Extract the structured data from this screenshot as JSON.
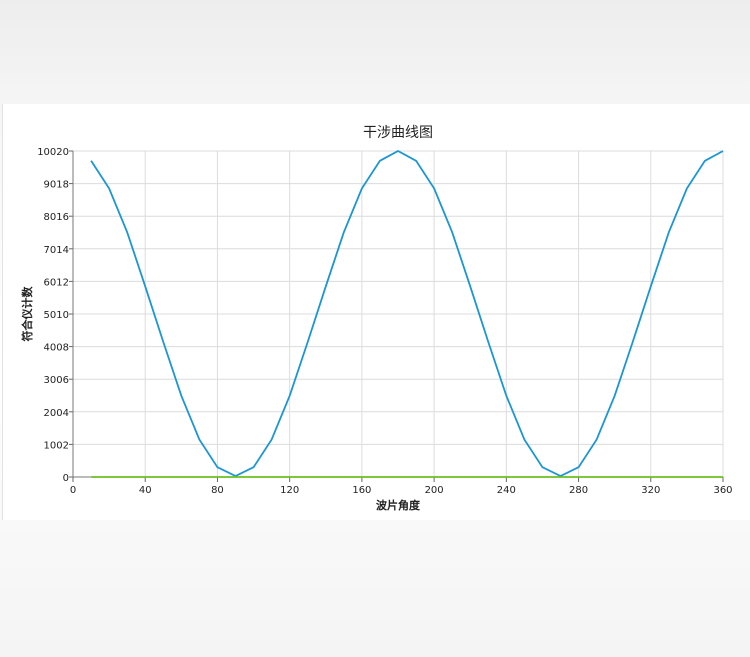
{
  "chart_data": {
    "type": "line",
    "title": "干涉曲线图",
    "xlabel": "波片角度",
    "ylabel": "符合仪计数",
    "xlim": [
      0,
      360
    ],
    "ylim": [
      0,
      10020
    ],
    "x_ticks": [
      "0",
      "40",
      "80",
      "120",
      "160",
      "200",
      "240",
      "280",
      "320",
      "360"
    ],
    "y_ticks": [
      "0",
      "1002",
      "2004",
      "3006",
      "4008",
      "5010",
      "6012",
      "7014",
      "8016",
      "9018",
      "10020"
    ],
    "grid": true,
    "series": [
      {
        "color": "#1a96d4",
        "x": [
          10,
          20,
          30,
          40,
          50,
          60,
          70,
          80,
          90,
          100,
          110,
          120,
          130,
          140,
          150,
          160,
          170,
          180,
          190,
          200,
          210,
          220,
          230,
          240,
          250,
          260,
          270,
          280,
          290,
          300,
          310,
          320,
          330,
          340,
          350,
          360
        ],
        "y": [
          9720,
          8870,
          7520,
          5860,
          4150,
          2500,
          1150,
          300,
          30,
          300,
          1150,
          2500,
          4150,
          5860,
          7520,
          8870,
          9720,
          10020,
          9720,
          8870,
          7520,
          5860,
          4150,
          2500,
          1150,
          300,
          30,
          300,
          1150,
          2500,
          4150,
          5860,
          7520,
          8870,
          9720,
          10020
        ]
      },
      {
        "color": "#6cbf1e",
        "x": [
          10,
          360
        ],
        "y": [
          0,
          0
        ]
      }
    ]
  }
}
